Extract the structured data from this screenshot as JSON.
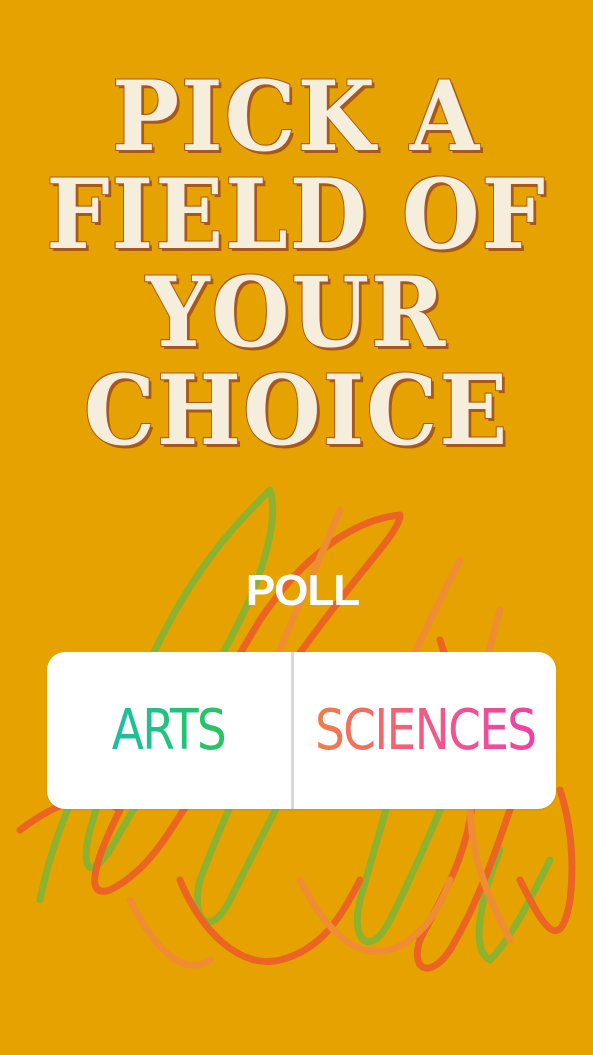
{
  "story": {
    "background_color": "#e6a300",
    "title_lines": [
      "PICK A",
      "FIELD OF",
      "YOUR",
      "CHOICE"
    ],
    "title_fill_color": "#f6eedd",
    "title_outline_color": "#a8581b"
  },
  "poll": {
    "label": "POLL",
    "options": [
      {
        "label": "ARTS",
        "gradient": [
          "#1cbfa3",
          "#27c55c"
        ]
      },
      {
        "label": "SCIENCES",
        "gradient": [
          "#f27d44",
          "#f25a85",
          "#ee41a6"
        ]
      }
    ]
  },
  "decoration": {
    "scribble_colors": [
      "#7cb63a",
      "#ee5a2a",
      "#f08a3a"
    ]
  }
}
